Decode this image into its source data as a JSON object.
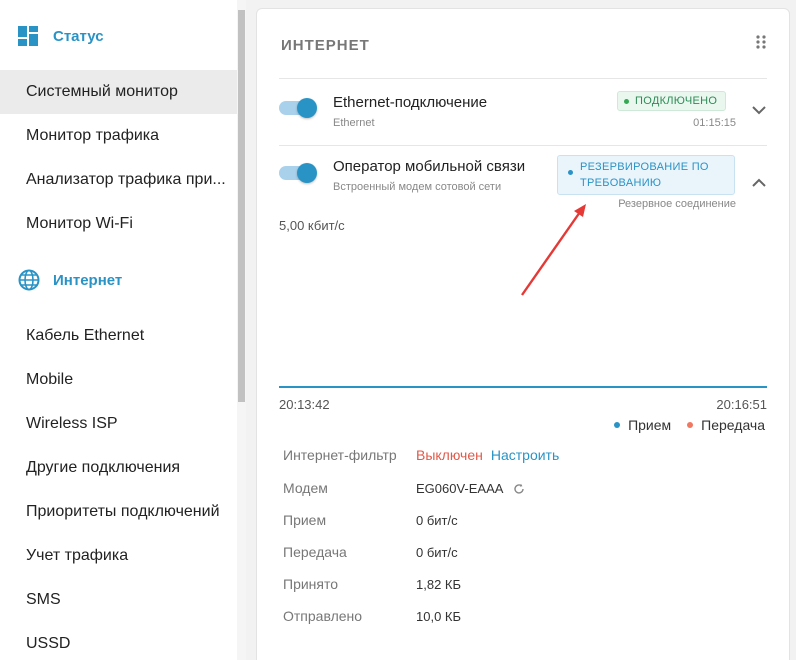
{
  "sidebar": {
    "status_section": "Статус",
    "status_items": [
      "Системный монитор",
      "Монитор трафика",
      "Анализатор трафика при...",
      "Монитор Wi-Fi"
    ],
    "internet_section": "Интернет",
    "internet_items": [
      "Кабель Ethernet",
      "Mobile",
      "Wireless ISP",
      "Другие подключения",
      "Приоритеты подключений",
      "Учет трафика",
      "SMS",
      "USSD"
    ]
  },
  "card": {
    "title": "ИНТЕРНЕТ",
    "connections": [
      {
        "name": "Ethernet-подключение",
        "sub": "Ethernet",
        "enabled": true,
        "badge": "ПОДКЛЮЧЕНО",
        "right_text": "01:15:15",
        "expanded": false
      },
      {
        "name": "Оператор мобильной связи",
        "sub": "Встроенный модем сотовой сети",
        "enabled": true,
        "badge": "РЕЗЕРВИРОВАНИЕ ПО ТРЕБОВАНИЮ",
        "right_text": "Резервное соединение",
        "expanded": true
      }
    ],
    "chart": {
      "max_label": "5,00 кбит/с",
      "t_start": "20:13:42",
      "t_end": "20:16:51",
      "legend_rx": "Прием",
      "legend_tx": "Передача"
    },
    "info": {
      "filter_label": "Интернет-фильтр",
      "filter_value": "Выключен",
      "filter_link": "Настроить",
      "modem_label": "Модем",
      "modem_value": "EG060V-EAAA",
      "rx_label": "Прием",
      "rx_value": "0 бит/с",
      "tx_label": "Передача",
      "tx_value": "0 бит/с",
      "received_label": "Принято",
      "received_value": "1,82 КБ",
      "sent_label": "Отправлено",
      "sent_value": "10,0 КБ"
    }
  },
  "colors": {
    "accent": "#2a93c6",
    "ok": "#34a853",
    "off": "#e05a4a",
    "tx": "#f07860",
    "annotation": "#e53935"
  },
  "icons": {
    "status": "dashboard-icon",
    "internet": "globe-icon",
    "grip": "grip-icon",
    "expand": "chevron-down-icon",
    "collapse": "chevron-up-icon",
    "refresh": "refresh-icon"
  }
}
